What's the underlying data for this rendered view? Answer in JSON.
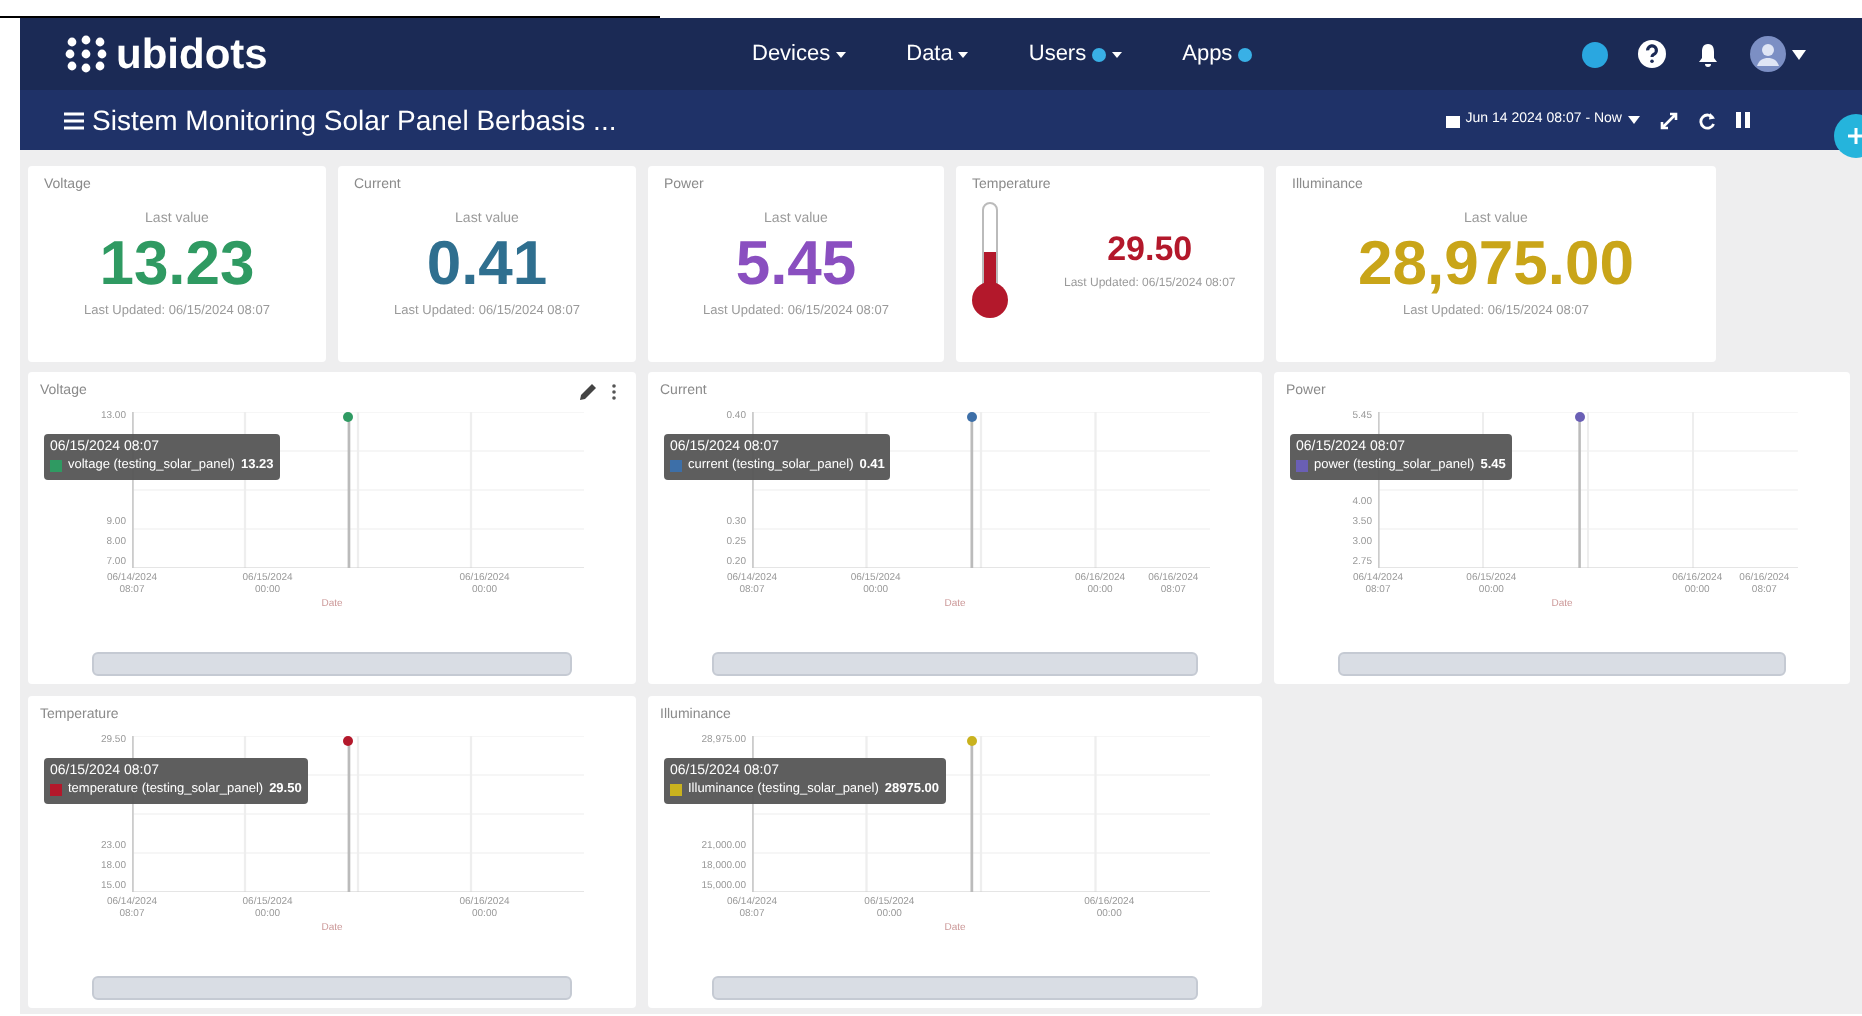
{
  "navbar": {
    "logo": "ubidots",
    "menu": [
      {
        "label": "Devices",
        "dropdown": true,
        "dot": false
      },
      {
        "label": "Data",
        "dropdown": true,
        "dot": false
      },
      {
        "label": "Users",
        "dropdown": true,
        "dot": true
      },
      {
        "label": "Apps",
        "dropdown": false,
        "dot": true
      }
    ]
  },
  "dashboard_bar": {
    "title": "Sistem Monitoring Solar Panel Berbasis ...",
    "date_range": "Jun 14 2024 08:07 - Now"
  },
  "metrics": [
    {
      "kind": "value",
      "title": "Voltage",
      "caption": "Last value",
      "value": "13.23",
      "updated": "Last Updated: 06/15/2024 08:07",
      "color": "#2f9a62"
    },
    {
      "kind": "value",
      "title": "Current",
      "caption": "Last value",
      "value": "0.41",
      "updated": "Last Updated: 06/15/2024 08:07",
      "color": "#2f6f8f"
    },
    {
      "kind": "value",
      "title": "Power",
      "caption": "Last value",
      "value": "5.45",
      "updated": "Last Updated: 06/15/2024 08:07",
      "color": "#8a4fc0"
    },
    {
      "kind": "thermometer",
      "title": "Temperature",
      "value": "29.50",
      "updated": "Last Updated: 06/15/2024 08:07",
      "color": "#b3182b",
      "level": 0.45
    },
    {
      "kind": "value",
      "title": "Illuminance",
      "caption": "Last value",
      "value": "28,975.00",
      "updated": "Last Updated: 06/15/2024 08:07",
      "color": "#c9a519"
    }
  ],
  "charts": [
    {
      "title": "Voltage",
      "editable": true,
      "color": "#2f9a62",
      "y_tick_labels": [
        "13.00",
        "9.00",
        "8.00",
        "7.00"
      ],
      "x_tick_labels": [
        {
          "date": "06/14/2024",
          "time": "08:07"
        },
        {
          "date": "06/15/2024",
          "time": "00:00"
        },
        {
          "date": "06/16/2024",
          "time": "00:00"
        }
      ],
      "xlabel": "Date",
      "tooltip": {
        "time": "06/15/2024 08:07",
        "series": "voltage (testing_solar_panel)",
        "value": "13.23"
      }
    },
    {
      "title": "Current",
      "editable": false,
      "color": "#3d6fa8",
      "y_tick_labels": [
        "0.40",
        "0.30",
        "0.25",
        "0.20"
      ],
      "x_tick_labels": [
        {
          "date": "06/14/2024",
          "time": "08:07"
        },
        {
          "date": "06/15/2024",
          "time": "00:00"
        },
        {
          "date": "06/16/2024",
          "time": "00:00"
        },
        {
          "date": "06/16/2024",
          "time": "08:07"
        }
      ],
      "xlabel": "Date",
      "tooltip": {
        "time": "06/15/2024 08:07",
        "series": "current (testing_solar_panel)",
        "value": "0.41"
      }
    },
    {
      "title": "Power",
      "editable": false,
      "color": "#6a5fb5",
      "y_tick_labels": [
        "5.45",
        "4.00",
        "3.50",
        "3.00",
        "2.75"
      ],
      "x_tick_labels": [
        {
          "date": "06/14/2024",
          "time": "08:07"
        },
        {
          "date": "06/15/2024",
          "time": "00:00"
        },
        {
          "date": "06/16/2024",
          "time": "00:00"
        },
        {
          "date": "06/16/2024",
          "time": "08:07"
        }
      ],
      "xlabel": "Date",
      "tooltip": {
        "time": "06/15/2024 08:07",
        "series": "power (testing_solar_panel)",
        "value": "5.45"
      }
    },
    {
      "title": "Temperature",
      "editable": false,
      "color": "#b3182b",
      "y_tick_labels": [
        "29.50",
        "23.00",
        "18.00",
        "15.00"
      ],
      "x_tick_labels": [
        {
          "date": "06/14/2024",
          "time": "08:07"
        },
        {
          "date": "06/15/2024",
          "time": "00:00"
        },
        {
          "date": "06/16/2024",
          "time": "00:00"
        }
      ],
      "xlabel": "Date",
      "tooltip": {
        "time": "06/15/2024 08:07",
        "series": "temperature (testing_solar_panel)",
        "value": "29.50"
      }
    },
    {
      "title": "Illuminance",
      "editable": false,
      "color": "#c9b21e",
      "y_tick_labels": [
        "28,975.00",
        "21,000.00",
        "18,000.00",
        "15,000.00"
      ],
      "x_tick_labels": [
        {
          "date": "06/14/2024",
          "time": "08:07"
        },
        {
          "date": "06/15/2024",
          "time": "00:00"
        },
        {
          "date": "06/16/2024",
          "time": "00:00"
        }
      ],
      "xlabel": "Date",
      "tooltip": {
        "time": "06/15/2024 08:07",
        "series": "Illuminance (testing_solar_panel)",
        "value": "28975.00"
      }
    }
  ]
}
